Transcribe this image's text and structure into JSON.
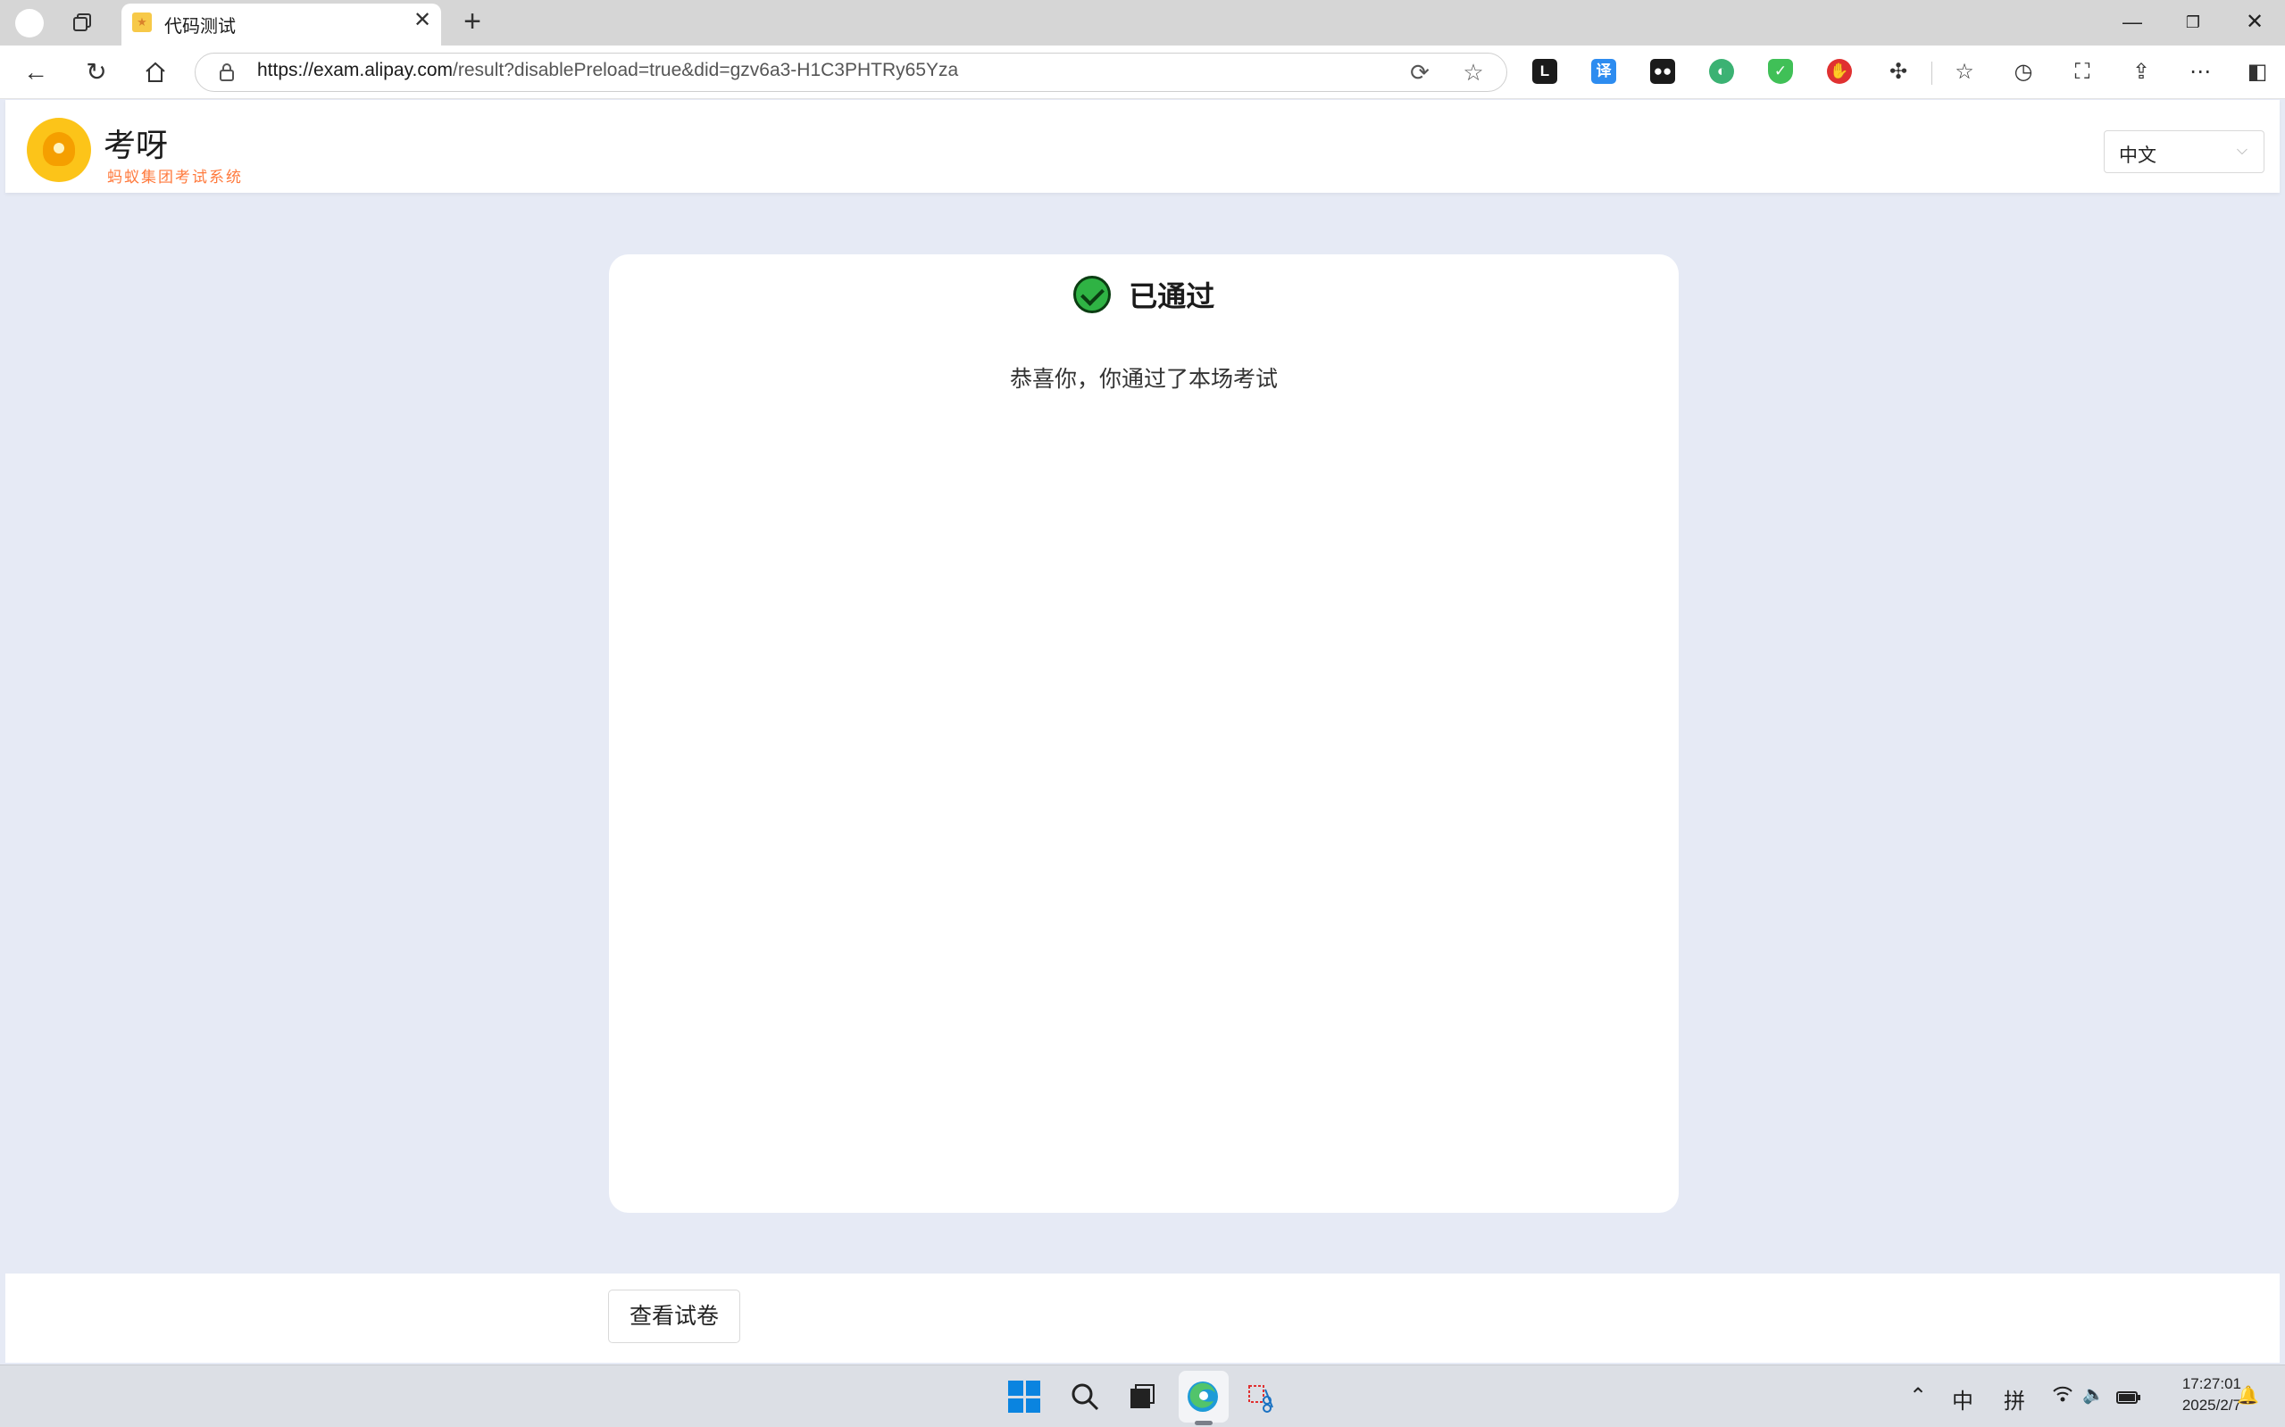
{
  "browser": {
    "tab_title": "代码测试",
    "tab_close": "✕",
    "new_tab": "+",
    "url_host": "https://exam.alipay.com",
    "url_path": "/result?disablePreload=true&did=gzv6a3-H1C3PHTRy65Yza",
    "ext_translate_label": "译",
    "ext_l_label": "L",
    "icons": [
      "profile-icon",
      "tab-actions-icon",
      "back-icon",
      "reload-icon",
      "home-icon",
      "lock-icon",
      "immersive-reader-icon",
      "favorite-star-icon",
      "extensions-icon",
      "favorites-icon",
      "history-icon",
      "screenshot-icon",
      "share-icon",
      "more-icon",
      "sidebar-icon"
    ]
  },
  "header": {
    "brand_name": "考呀",
    "brand_subtitle": "蚂蚁集团考试系统",
    "language": "中文"
  },
  "result": {
    "status": "已通过",
    "message": "恭喜你，你通过了本场考试"
  },
  "footer": {
    "review_button": "查看试卷"
  },
  "taskbar": {
    "ime_mode": "中",
    "ime_type": "拼",
    "time": "17:27:01",
    "date": "2025/2/7"
  },
  "colors": {
    "page_bg": "#e6eaf5",
    "success": "#2fb344",
    "brand_orange": "#ff7a3d",
    "logo_yellow": "#fcc419"
  }
}
